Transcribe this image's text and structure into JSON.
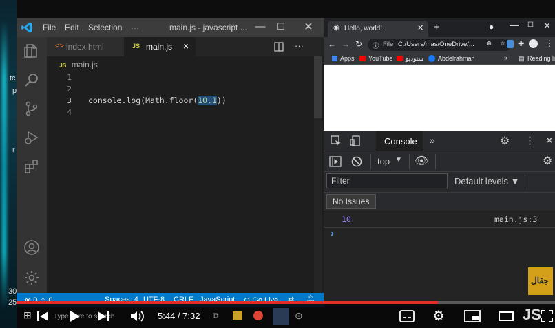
{
  "left_strip": {
    "text_1": "tc",
    "text_2": "p",
    "text_3": "r",
    "bottom_1": "30",
    "bottom_2": "25"
  },
  "vscode": {
    "menu": [
      "File",
      "Edit",
      "Selection",
      "···"
    ],
    "window_title": "main.js - javascript ...",
    "tabs": [
      {
        "icon": "<>",
        "label": "index.html"
      },
      {
        "icon": "JS",
        "label": "main.js",
        "close": "×"
      }
    ],
    "breadcrumb": {
      "icon": "JS",
      "label": "main.js"
    },
    "line_numbers": [
      "1",
      "2",
      "3",
      "4"
    ],
    "code": {
      "prefix": "console.log(Math.floor(",
      "selected": "10.1",
      "suffix": "))"
    },
    "status": {
      "problems": "⊗ 0 ⚠ 0",
      "spaces": "Spaces: 4",
      "encoding": "UTF-8",
      "eol": "CRLF",
      "language": "JavaScript",
      "live": "⊙ Go Live"
    }
  },
  "browser": {
    "tab_title": "Hello, world!",
    "address_prefix": "File",
    "address": "C:/Users/mas/OneDrive/...",
    "bookmarks": [
      {
        "label": "Apps",
        "color": "#4285f4"
      },
      {
        "label": "YouTube",
        "color": "#ff0000"
      },
      {
        "label": "ستوديو",
        "color": "#ff0000"
      },
      {
        "label": "Abdelrahman",
        "color": "#1877f2"
      }
    ],
    "reading_list": "Reading list",
    "more": "»"
  },
  "devtools": {
    "active_tab": "Console",
    "more": "»",
    "context": "top",
    "filter_placeholder": "Filter",
    "levels": "Default levels ▼",
    "issues": "No Issues",
    "log_value": "10",
    "log_source": "main.js:3",
    "prompt": "›"
  },
  "youtube": {
    "time": "5:44 / 7:32",
    "played_fraction": 0.782,
    "search_hint": "Type here to search",
    "badge": "جقال",
    "js_label": "JS"
  },
  "colors": {
    "vscode_accent": "#007acc",
    "selection": "#264f78",
    "number": "#b5cea8",
    "yt_red": "#e52d27",
    "console_number": "#9980ff"
  }
}
